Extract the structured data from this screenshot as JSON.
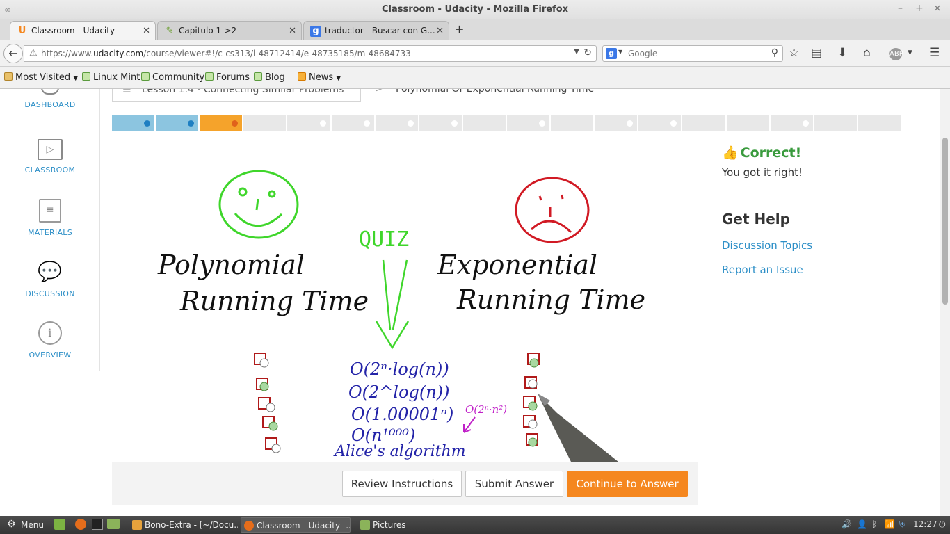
{
  "window": {
    "title": "Classroom - Udacity - Mozilla Firefox"
  },
  "tabs": [
    {
      "label": "Classroom - Udacity",
      "favicon": "U",
      "active": true
    },
    {
      "label": "Capitulo 1->2",
      "favicon": "edit-icon",
      "active": false
    },
    {
      "label": "traductor - Buscar con G...",
      "favicon": "g",
      "active": false
    }
  ],
  "nav": {
    "url_prefix": "https://www.",
    "url_domain": "udacity.com",
    "url_path": "/course/viewer#!/c-cs313/l-48712414/e-48735185/m-48684733",
    "search_placeholder": "Google"
  },
  "bookmarks": [
    {
      "label": "Most Visited",
      "dropdown": true
    },
    {
      "label": "Linux Mint"
    },
    {
      "label": "Community"
    },
    {
      "label": "Forums"
    },
    {
      "label": "Blog"
    },
    {
      "label": "News",
      "dropdown": true
    }
  ],
  "leftnav": [
    {
      "label": "DASHBOARD",
      "icon": "dashboard-icon"
    },
    {
      "label": "CLASSROOM",
      "icon": "play-icon"
    },
    {
      "label": "MATERIALS",
      "icon": "notebook-icon"
    },
    {
      "label": "DISCUSSION",
      "icon": "chat-bubbles-icon"
    },
    {
      "label": "OVERVIEW",
      "icon": "info-icon"
    }
  ],
  "breadcrumb": {
    "lesson": "Lesson 1.4 - Connecting Similar Problems",
    "separator": ">",
    "current": "Polynomial Or Exponential Running Time"
  },
  "progress": {
    "total_segments": 18,
    "completed": 2,
    "current_index": 2,
    "colors": {
      "done": "#8cc5e0",
      "current": "#f5a32b",
      "todo": "#e8e8e8"
    }
  },
  "quiz": {
    "left_heading": [
      "Polynomial",
      "Running Time"
    ],
    "right_heading": [
      "Exponential",
      "Running Time"
    ],
    "center_label": "QUIZ",
    "items": [
      "O(2ⁿ·log(n))",
      "O(2^log(n))",
      "O(1.00001ⁿ)",
      "O(n¹⁰⁰⁰)",
      "Alice's algorithm"
    ],
    "annotation": "O(2ⁿ·n²)"
  },
  "buttons": {
    "review": "Review Instructions",
    "submit": "Submit Answer",
    "continue": "Continue to Answer"
  },
  "feedback": {
    "title": "Correct!",
    "message": "You got it right!"
  },
  "help": {
    "heading": "Get Help",
    "discussion": "Discussion Topics",
    "report": "Report an Issue"
  },
  "taskbar": {
    "menu": "Menu",
    "tasks": [
      {
        "label": "Bono-Extra - [~/Docu...",
        "active": false
      },
      {
        "label": "Classroom - Udacity -...",
        "active": true
      },
      {
        "label": "Pictures",
        "active": false
      }
    ],
    "clock": "12:27"
  }
}
